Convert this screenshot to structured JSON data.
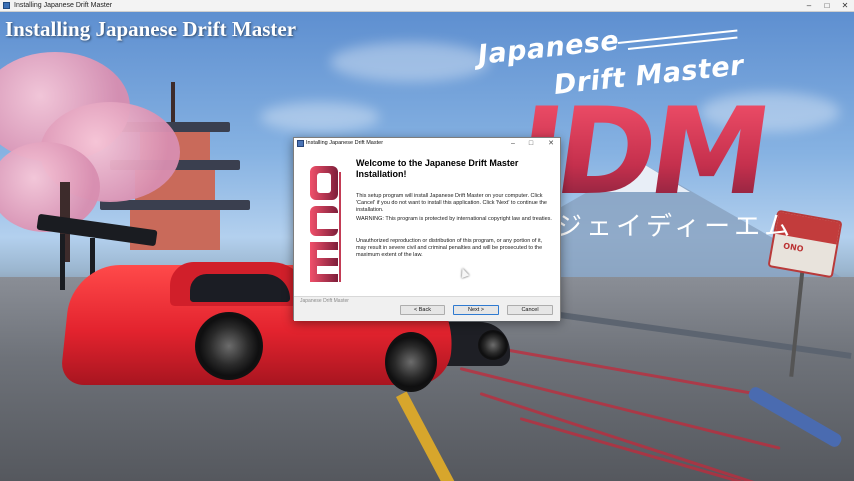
{
  "window": {
    "title": "Installing Japanese Drift Master",
    "minimize": "–",
    "maximize": "□",
    "close": "✕"
  },
  "page": {
    "heading": "Installing Japanese Drift Master"
  },
  "logo": {
    "line1": "Japanese",
    "line2": "Drift Master",
    "big": "JDM",
    "kana": "ジェイディーエム"
  },
  "sign": {
    "text": "ONO"
  },
  "dialog": {
    "title": "Installing Japanese Drift Master",
    "minimize": "–",
    "maximize": "□",
    "close": "✕",
    "heading": "Welcome to the Japanese Drift Master Installation!",
    "paragraphs": [
      "This setup program will install Japanese Drift Master on your computer. Click 'Cancel' if you do not want to install this application. Click 'Next' to continue the installation.",
      "WARNING: This program is protected by international copyright law and treaties.",
      "Unauthorized reproduction or distribution of this program, or any portion of it, may result in severe civil and criminal penalties and will be prosecuted to the maximum extent of the law."
    ],
    "brand": "Japanese Drift Master",
    "back_label": "< Back",
    "next_label": "Next >",
    "cancel_label": "Cancel"
  },
  "colors": {
    "accent_blue": "#2f7ad0",
    "logo_red": "#d8425a",
    "car_red": "#e3232e"
  }
}
